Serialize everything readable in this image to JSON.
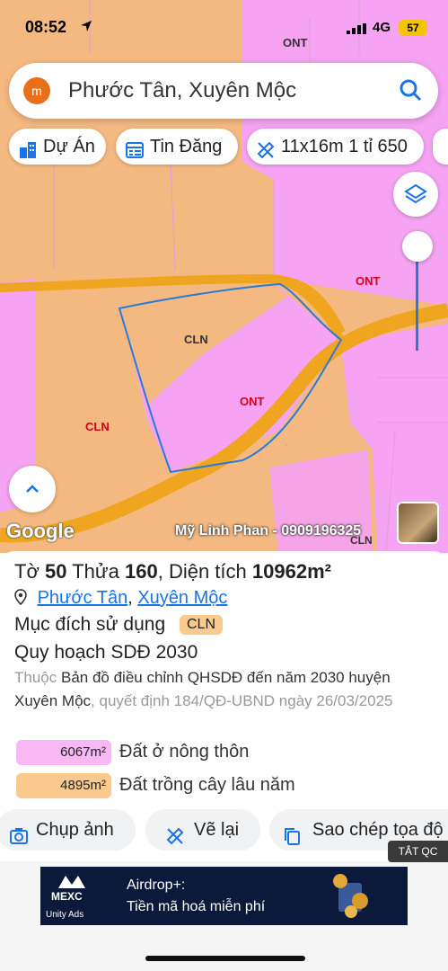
{
  "status_bar": {
    "time": "08:52",
    "network": "4G",
    "battery": "57"
  },
  "search": {
    "logo_letter": "m",
    "query": "Phước Tân, Xuyên Mộc"
  },
  "chips": [
    {
      "label": "Dự Án",
      "icon": "building-icon"
    },
    {
      "label": "Tin Đăng",
      "icon": "list-icon"
    },
    {
      "label": "11x16m 1 tỉ 650",
      "icon": "ruler-icon"
    }
  ],
  "map_labels": {
    "ont_top": "ONT",
    "ont_right": "ONT",
    "cln_parcel": "CLN",
    "ont_parcel": "ONT",
    "cln_left": "CLN",
    "cln_bottom": "CLN"
  },
  "map_colors": {
    "ont": "#f5a3f2",
    "cln": "#f4b981",
    "road": "#f0a520",
    "boundary": "#2a7bd8"
  },
  "map_footer": {
    "google": "Google",
    "watermark": "Mỹ Linh Phan - 0909196325"
  },
  "parcel": {
    "title_prefix": "Tờ",
    "sheet_no": "50",
    "parcel_label": "Thửa",
    "parcel_no": "160",
    "area_label": "Diện tích",
    "area_value": "10962m²",
    "ward": "Phước Tân",
    "district": "Xuyên Mộc",
    "purpose_label": "Mục đích sử dụng",
    "purpose_code": "CLN",
    "plan_label": "Quy hoạch SDĐ 2030",
    "desc_prefix": "Thuộc",
    "desc_map": "Bản đồ điều chỉnh QHSDĐ đến năm 2030 huyện Xuyên Mộc",
    "desc_decision": ", quyết định 184/QĐ-UBND ngày 26/03/2025",
    "legend": [
      {
        "area": "6067m²",
        "label": "Đất ở nông thôn",
        "color": "#f7b8f3"
      },
      {
        "area": "4895m²",
        "label": "Đất trồng cây lâu năm",
        "color": "#f9c98e"
      }
    ]
  },
  "actions": [
    {
      "label": "Chụp ảnh",
      "icon": "camera-icon"
    },
    {
      "label": "Vẽ lại",
      "icon": "ruler-icon"
    },
    {
      "label": "Sao chép tọa độ",
      "icon": "copy-icon"
    }
  ],
  "ad": {
    "close_label": "TẮT QC",
    "brand": "MEXC",
    "network": "Unity Ads",
    "line1": "Airdrop+:",
    "line2": "Tiền mã hoá miễn phí"
  }
}
